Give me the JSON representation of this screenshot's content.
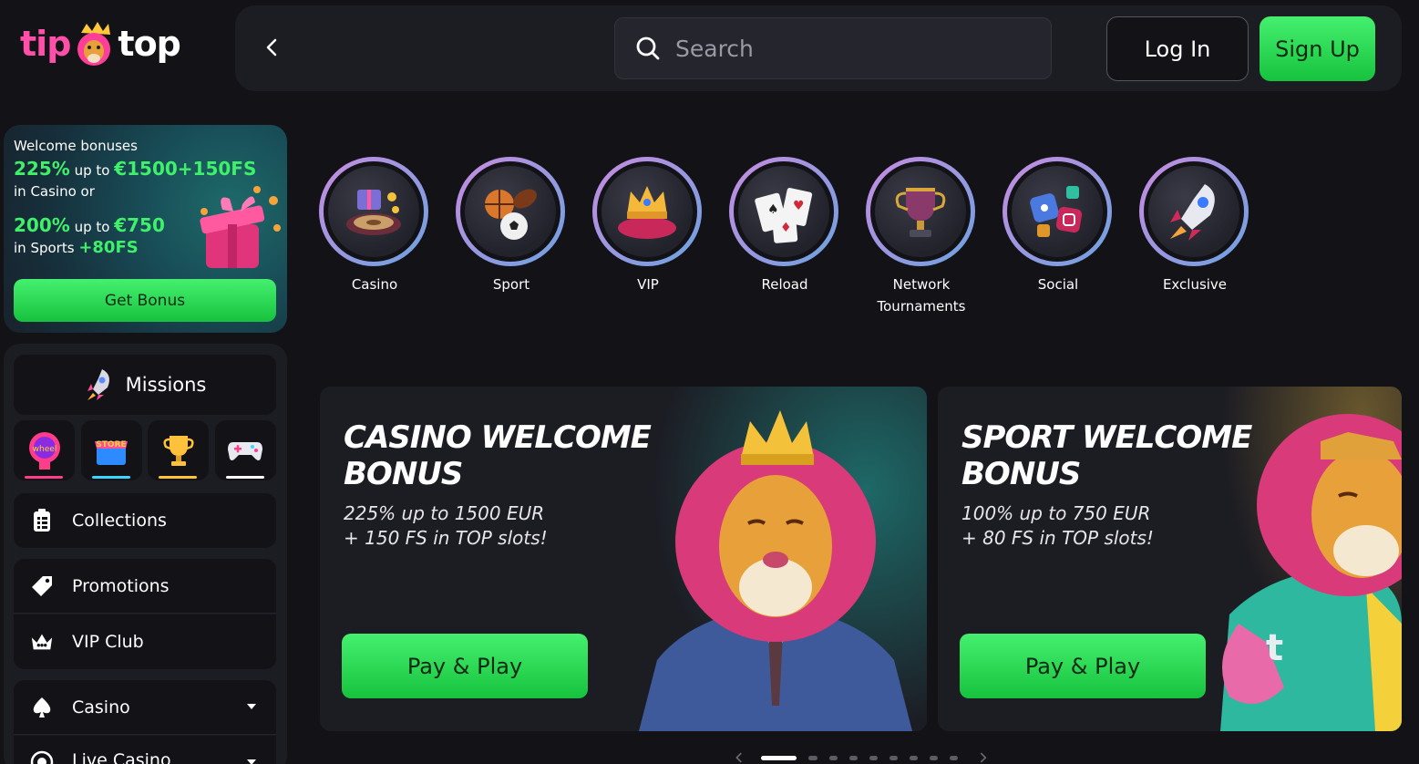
{
  "header": {
    "logo_left": "tip",
    "logo_right": "top",
    "search_placeholder": "Search",
    "login_label": "Log In",
    "signup_label": "Sign Up"
  },
  "bonus_card": {
    "title": "Welcome bonuses",
    "casino_pct": "225%",
    "casino_up_to": "up to",
    "casino_amount": "€1500+150FS",
    "casino_suffix": "in Casino or",
    "sport_pct": "200%",
    "sport_up_to": "up to",
    "sport_amount": "€750",
    "sport_prefix": "in Sports",
    "sport_fs": "+80FS",
    "button": "Get Bonus"
  },
  "sidebar": {
    "missions_label": "Missions",
    "mini_icons": [
      {
        "name": "wheel-icon",
        "color": "#ff3d8a"
      },
      {
        "name": "store-icon",
        "color": "#3ad6ff"
      },
      {
        "name": "trophy-icon",
        "color": "#ffc23a"
      },
      {
        "name": "gamepad-icon",
        "color": "#ffffff"
      }
    ],
    "items": [
      {
        "label": "Collections"
      },
      {
        "label": "Promotions"
      },
      {
        "label": "VIP Club"
      },
      {
        "label": "Casino"
      },
      {
        "label": "Live Casino"
      }
    ]
  },
  "categories": [
    {
      "label": "Casino"
    },
    {
      "label": "Sport"
    },
    {
      "label": "VIP"
    },
    {
      "label": "Reload"
    },
    {
      "label": "Network Tournaments"
    },
    {
      "label": "Social"
    },
    {
      "label": "Exclusive"
    }
  ],
  "banners": [
    {
      "title_line1": "CASINO WELCOME",
      "title_line2": "BONUS",
      "sub_line1": "225% up to 1500 EUR",
      "sub_line2": "+ 150 FS in TOP slots!",
      "button": "Pay & Play"
    },
    {
      "title_line1": "SPORT WELCOME",
      "title_line2": "BONUS",
      "sub_line1": "100% up to 750 EUR",
      "sub_line2": "+ 80 FS in TOP slots!",
      "button": "Pay & Play"
    }
  ],
  "pager": {
    "pages": 9,
    "active_index": 0
  },
  "colors": {
    "accent_green": "#2bd955",
    "brand_pink": "#ff4fa8",
    "background": "#121217",
    "panel": "#1c1c23"
  }
}
